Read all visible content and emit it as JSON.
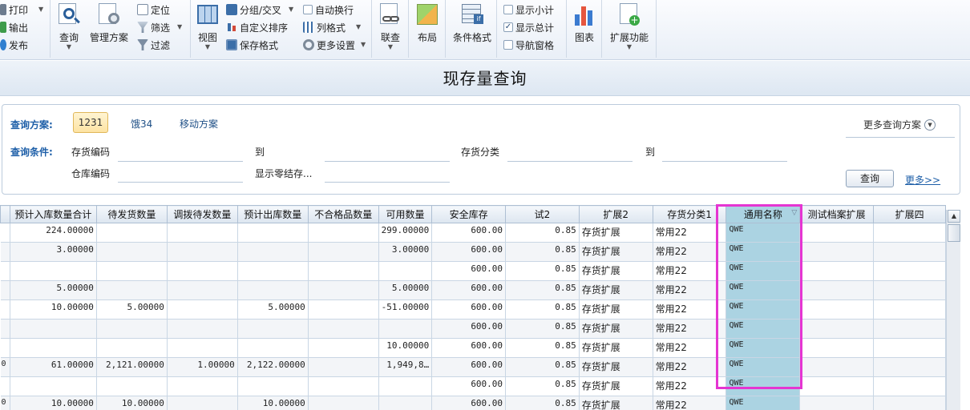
{
  "toolbar": {
    "print": "打印",
    "export": "输出",
    "publish": "发布",
    "query": "查询",
    "manage_scheme": "管理方案",
    "locate": "定位",
    "filter": "筛选",
    "filter2": "过滤",
    "view": "视图",
    "group_cross": "分组/交叉",
    "custom_sort": "自定义排序",
    "save_format": "保存格式",
    "auto_wrap": "自动换行",
    "column_format": "列格式",
    "more_settings": "更多设置",
    "link_query": "联查",
    "layout": "布局",
    "condition_format": "条件格式",
    "show_subtotal": "显示小计",
    "show_total": "显示总计",
    "nav_pane": "导航窗格",
    "chart": "图表",
    "extend": "扩展功能",
    "show_total_checked": true,
    "show_subtotal_checked": false,
    "nav_pane_checked": false,
    "auto_wrap_checked": false
  },
  "page": {
    "title": "现存量查询"
  },
  "query": {
    "scheme_label": "查询方案:",
    "schemes": [
      "1231",
      "饿34",
      "移动方案"
    ],
    "more_schemes": "更多查询方案",
    "condition_label": "查询条件:",
    "f_inventory_code": "存货编码",
    "f_to1": "到",
    "f_inventory_class": "存货分类",
    "f_to2": "到",
    "f_warehouse_code": "仓库编码",
    "f_show_zero": "显示零结存...",
    "query_button": "查询",
    "more_link": "更多>>"
  },
  "grid": {
    "headers": [
      "",
      "预计入库数量合计",
      "待发货数量",
      "调拨待发数量",
      "预计出库数量",
      "不合格品数量",
      "可用数量",
      "安全库存",
      "试2",
      "扩展2",
      "存货分类1",
      "通用名称",
      "测试档案扩展",
      "扩展四"
    ],
    "rows": [
      [
        "",
        "224.00000",
        "",
        "",
        "",
        "",
        "299.00000",
        "600.00",
        "0.85",
        "存货扩展",
        "常用22",
        "QWE",
        "",
        ""
      ],
      [
        "",
        "3.00000",
        "",
        "",
        "",
        "",
        "3.00000",
        "600.00",
        "0.85",
        "存货扩展",
        "常用22",
        "QWE",
        "",
        ""
      ],
      [
        "",
        "",
        "",
        "",
        "",
        "",
        "",
        "600.00",
        "0.85",
        "存货扩展",
        "常用22",
        "QWE",
        "",
        ""
      ],
      [
        "",
        "5.00000",
        "",
        "",
        "",
        "",
        "5.00000",
        "600.00",
        "0.85",
        "存货扩展",
        "常用22",
        "QWE",
        "",
        ""
      ],
      [
        "",
        "10.00000",
        "5.00000",
        "",
        "5.00000",
        "",
        "-51.00000",
        "600.00",
        "0.85",
        "存货扩展",
        "常用22",
        "QWE",
        "",
        ""
      ],
      [
        "",
        "",
        "",
        "",
        "",
        "",
        "",
        "600.00",
        "0.85",
        "存货扩展",
        "常用22",
        "QWE",
        "",
        ""
      ],
      [
        "",
        "",
        "",
        "",
        "",
        "",
        "10.00000",
        "600.00",
        "0.85",
        "存货扩展",
        "常用22",
        "QWE",
        "",
        ""
      ],
      [
        "0",
        "61.00000",
        "2,121.00000",
        "1.00000",
        "2,122.00000",
        "",
        "1,949,8…",
        "600.00",
        "0.85",
        "存货扩展",
        "常用22",
        "QWE",
        "",
        ""
      ],
      [
        "",
        "",
        "",
        "",
        "",
        "",
        "",
        "600.00",
        "0.85",
        "存货扩展",
        "常用22",
        "QWE",
        "",
        ""
      ],
      [
        "0",
        "10.00000",
        "10.00000",
        "",
        "10.00000",
        "",
        "",
        "600.00",
        "0.85",
        "存货扩展",
        "常用22",
        "QWE",
        "",
        ""
      ]
    ],
    "highlight_color": "#e535d2",
    "selected_column_color": "#abd3e2"
  }
}
